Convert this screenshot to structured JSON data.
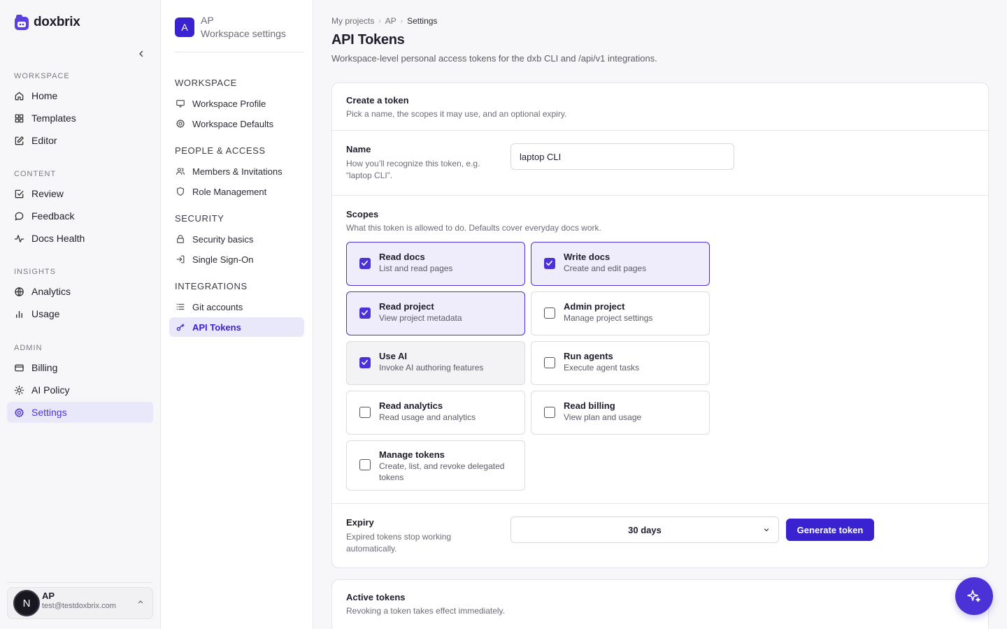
{
  "brand": {
    "name": "doxbrix",
    "accent": "#4a32d6",
    "accent_dark": "#3a22d0"
  },
  "sidebar": {
    "sections": [
      {
        "label": "WORKSPACE",
        "items": [
          {
            "label": "Home",
            "icon": "home-icon"
          },
          {
            "label": "Templates",
            "icon": "grid-icon"
          },
          {
            "label": "Editor",
            "icon": "edit-icon"
          }
        ]
      },
      {
        "label": "CONTENT",
        "items": [
          {
            "label": "Review",
            "icon": "check-square-icon"
          },
          {
            "label": "Feedback",
            "icon": "message-icon"
          },
          {
            "label": "Docs Health",
            "icon": "pulse-icon"
          }
        ]
      },
      {
        "label": "INSIGHTS",
        "items": [
          {
            "label": "Analytics",
            "icon": "globe-icon"
          },
          {
            "label": "Usage",
            "icon": "bar-chart-icon"
          }
        ]
      },
      {
        "label": "ADMIN",
        "items": [
          {
            "label": "Billing",
            "icon": "credit-card-icon"
          },
          {
            "label": "AI Policy",
            "icon": "sun-icon"
          },
          {
            "label": "Settings",
            "icon": "gear-icon",
            "active": true
          }
        ]
      }
    ],
    "user": {
      "initial": "N",
      "name": "AP",
      "email": "test@testdoxbrix.com"
    }
  },
  "settings_nav": {
    "workspace": {
      "badge": "A",
      "name": "AP",
      "subtitle": "Workspace settings"
    },
    "sections": [
      {
        "label": "WORKSPACE",
        "items": [
          {
            "label": "Workspace Profile",
            "icon": "monitor-icon"
          },
          {
            "label": "Workspace Defaults",
            "icon": "gear-icon"
          }
        ]
      },
      {
        "label": "PEOPLE & ACCESS",
        "items": [
          {
            "label": "Members & Invitations",
            "icon": "users-icon"
          },
          {
            "label": "Role Management",
            "icon": "shield-icon"
          }
        ]
      },
      {
        "label": "SECURITY",
        "items": [
          {
            "label": "Security basics",
            "icon": "lock-icon"
          },
          {
            "label": "Single Sign-On",
            "icon": "sign-in-icon"
          }
        ]
      },
      {
        "label": "INTEGRATIONS",
        "items": [
          {
            "label": "Git accounts",
            "icon": "list-icon"
          },
          {
            "label": "API Tokens",
            "icon": "key-icon",
            "active": true
          }
        ]
      }
    ]
  },
  "breadcrumb": [
    "My projects",
    "AP",
    "Settings"
  ],
  "page": {
    "title": "API Tokens",
    "subtitle": "Workspace-level personal access tokens for the dxb CLI and /api/v1 integrations."
  },
  "create": {
    "title": "Create a token",
    "subtitle": "Pick a name, the scopes it may use, and an optional expiry.",
    "name": {
      "label": "Name",
      "help": "How you’ll recognize this token, e.g. “laptop CLI”.",
      "value": "laptop CLI"
    },
    "scopes": {
      "label": "Scopes",
      "help": "What this token is allowed to do. Defaults cover everyday docs work.",
      "items": [
        {
          "name": "Read docs",
          "desc": "List and read pages",
          "checked": true
        },
        {
          "name": "Write docs",
          "desc": "Create and edit pages",
          "checked": true
        },
        {
          "name": "Read project",
          "desc": "View project metadata",
          "checked": true
        },
        {
          "name": "Admin project",
          "desc": "Manage project settings",
          "checked": false
        },
        {
          "name": "Use AI",
          "desc": "Invoke AI authoring features",
          "checked": true
        },
        {
          "name": "Run agents",
          "desc": "Execute agent tasks",
          "checked": false
        },
        {
          "name": "Read analytics",
          "desc": "Read usage and analytics",
          "checked": false
        },
        {
          "name": "Read billing",
          "desc": "View plan and usage",
          "checked": false
        },
        {
          "name": "Manage tokens",
          "desc": "Create, list, and revoke delegated tokens",
          "checked": false
        }
      ]
    },
    "expiry": {
      "label": "Expiry",
      "help": "Expired tokens stop working automatically.",
      "value": "30 days"
    },
    "generate_label": "Generate token"
  },
  "active": {
    "title": "Active tokens",
    "subtitle": "Revoking a token takes effect immediately."
  },
  "fab": {
    "icon": "sparkle-icon"
  }
}
